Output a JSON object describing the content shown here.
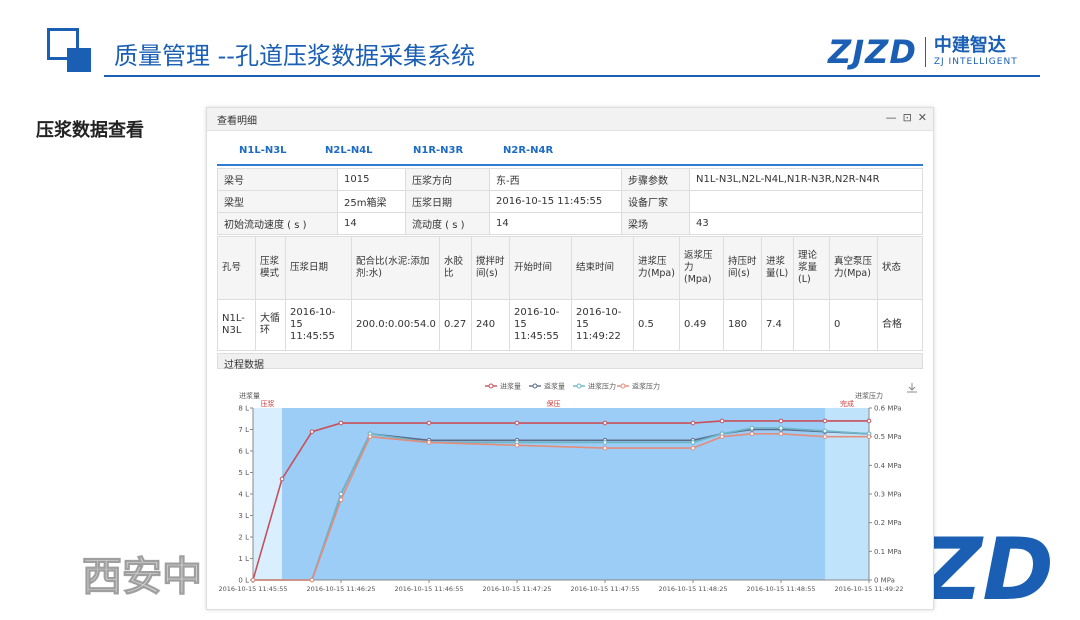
{
  "slide": {
    "title": "质量管理 --孔道压浆数据采集系统",
    "section_heading": "压浆数据查看",
    "brand_logo": "ZJZD",
    "brand_cn": "中建智达",
    "brand_en": "ZJ INTELLIGENT",
    "watermark_left": "西安中",
    "watermark_right": "ZD"
  },
  "panel": {
    "title": "查看明细",
    "controls": {
      "minimize": "—",
      "restore": "⊡",
      "close": "✕"
    },
    "tabs": [
      "N1L-N3L",
      "N2L-N4L",
      "N1R-N3R",
      "N2R-N4R"
    ]
  },
  "info": {
    "row1": {
      "l1": "梁号",
      "v1": "1015",
      "l2": "压浆方向",
      "v2": "东-西",
      "l3": "步骤参数",
      "v3": "N1L-N3L,N2L-N4L,N1R-N3R,N2R-N4R"
    },
    "row2": {
      "l1": "梁型",
      "v1": "25m箱梁",
      "l2": "压浆日期",
      "v2": "2016-10-15 11:45:55",
      "l3": "设备厂家",
      "v3": ""
    },
    "row3": {
      "l1": "初始流动速度 ( s )",
      "v1": "14",
      "l2": "流动度 ( s )",
      "v2": "14",
      "l3": "梁场",
      "v3": "43"
    }
  },
  "detail": {
    "headers": [
      "孔号",
      "压浆模式",
      "压浆日期",
      "配合比(水泥:添加剂:水)",
      "水胶比",
      "搅拌时间(s)",
      "开始时间",
      "结束时间",
      "进浆压力(Mpa)",
      "返浆压力(Mpa)",
      "持压时间(s)",
      "进浆量(L)",
      "理论浆量(L)",
      "真空泵压力(Mpa)",
      "状态"
    ],
    "row": [
      "N1L-N3L",
      "大循环",
      "2016-10-15 11:45:55",
      "200.0:0.00:54.0",
      "0.27",
      "240",
      "2016-10-15 11:45:55",
      "2016-10-15 11:49:22",
      "0.5",
      "0.49",
      "180",
      "7.4",
      "",
      "0",
      "合格"
    ]
  },
  "process": {
    "label": "过程数据"
  },
  "chart_data": {
    "type": "line",
    "legend": [
      "进浆量",
      "返浆量",
      "进浆压力",
      "返浆压力"
    ],
    "legend_position": "top-center",
    "left_axis_title": "进浆量",
    "right_axis_title": "进浆压力",
    "left_ticks": [
      "0 L",
      "1 L",
      "2 L",
      "3 L",
      "4 L",
      "5 L",
      "6 L",
      "7 L",
      "8 L"
    ],
    "right_ticks": [
      "0 MPa",
      "0.1 MPa",
      "0.2 MPa",
      "0.3 MPa",
      "0.4 MPa",
      "0.5 MPa",
      "0.6 MPa"
    ],
    "x_ticks": [
      "2016-10-15 11:45:55",
      "2016-10-15 11:46:25",
      "2016-10-15 11:46:55",
      "2016-10-15 11:47:25",
      "2016-10-15 11:47:55",
      "2016-10-15 11:48:25",
      "2016-10-15 11:48:55",
      "2016-10-15 11:49:22"
    ],
    "ylim_left": [
      0,
      8
    ],
    "ylim_right": [
      0,
      0.6
    ],
    "bands": [
      {
        "label": "压浆",
        "from": 0,
        "to": 0.33,
        "color": "#d9efff"
      },
      {
        "label": "保压",
        "from": 0.33,
        "to": 6.5,
        "color": "#9ccdf7"
      },
      {
        "label": "完成",
        "from": 6.5,
        "to": 7,
        "color": "#bfe3fb"
      }
    ],
    "series": [
      {
        "name": "进浆量",
        "axis": "left",
        "color": "#c8505a",
        "x": [
          0,
          0.33,
          0.67,
          1,
          2,
          3,
          4,
          5,
          5.33,
          6,
          6.5,
          7
        ],
        "y": [
          0,
          4.7,
          6.9,
          7.3,
          7.3,
          7.3,
          7.3,
          7.3,
          7.4,
          7.4,
          7.4,
          7.4
        ]
      },
      {
        "name": "返浆量",
        "axis": "left",
        "color": "#5d6b8a",
        "x": [
          0,
          0.67,
          1,
          1.33,
          2,
          3,
          4,
          5,
          5.33,
          5.67,
          6,
          6.5,
          7
        ],
        "y": [
          0,
          0,
          4.0,
          6.8,
          6.5,
          6.5,
          6.5,
          6.5,
          6.8,
          7.0,
          7.0,
          6.9,
          6.8
        ]
      },
      {
        "name": "进浆压力",
        "axis": "right",
        "color": "#6bb6c7",
        "x": [
          0,
          0.67,
          1,
          1.33,
          2,
          3,
          4,
          5,
          5.33,
          5.67,
          6,
          6.5,
          7
        ],
        "y": [
          0,
          0,
          0.3,
          0.51,
          0.48,
          0.48,
          0.48,
          0.48,
          0.51,
          0.53,
          0.53,
          0.52,
          0.51
        ]
      },
      {
        "name": "返浆压力",
        "axis": "right",
        "color": "#e38c7a",
        "x": [
          0,
          0.67,
          1,
          1.33,
          2,
          3,
          4,
          5,
          5.33,
          5.67,
          6,
          6.5,
          7
        ],
        "y": [
          0,
          0,
          0.28,
          0.5,
          0.48,
          0.47,
          0.46,
          0.46,
          0.5,
          0.51,
          0.51,
          0.5,
          0.5
        ]
      }
    ]
  }
}
